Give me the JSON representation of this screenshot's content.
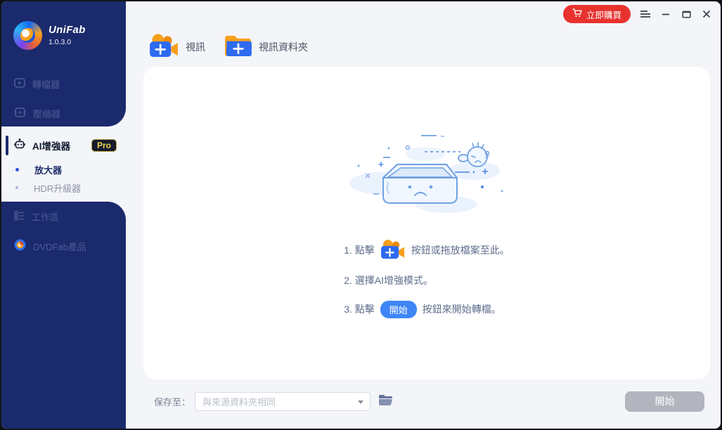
{
  "app": {
    "brand": "UniFab",
    "version": "1.0.3.0"
  },
  "titlebar": {
    "buy_label": "立即購買"
  },
  "sidebar": {
    "items": [
      {
        "label": "轉檔器"
      },
      {
        "label": "壓縮器"
      },
      {
        "label": "AI增強器",
        "badge": "Pro"
      },
      {
        "label": "放大器"
      },
      {
        "label": "HDR升級器"
      },
      {
        "label": "工作區"
      },
      {
        "label": "DVDFab產品"
      }
    ]
  },
  "toolbar": {
    "add_video_label": "視訊",
    "add_video_folder_label": "視訊資料夾"
  },
  "empty_state": {
    "step1_pre": "1. 點擊",
    "step1_post": "按鈕或拖放檔案至此。",
    "step2": "2. 選擇AI增強模式。",
    "step3_pre": "3. 點擊",
    "step3_button": "開始",
    "step3_post": "按鈕來開始轉檔。"
  },
  "bottombar": {
    "save_label": "保存至：",
    "save_value": "與來源資料夾相同",
    "start_label": "開始"
  },
  "icons": {
    "logo": "unifab-swirl",
    "buy": "cart-icon",
    "toolbar": [
      "add-video-camera-icon",
      "add-video-folder-icon"
    ],
    "sidebar": [
      "converter-play-icon",
      "compressor-icon",
      "ai-robot-icon",
      "workspace-list-icon",
      "dvdfab-logo-icon"
    ],
    "window": [
      "menu-icon",
      "minimize-icon",
      "maximize-icon",
      "close-icon"
    ],
    "bottom": [
      "dropdown-arrow-icon",
      "browse-folder-icon"
    ]
  },
  "colors": {
    "sidebar_navy": "#1a2a6c",
    "main_bg": "#f4f5f9",
    "panel_bg": "#ffffff",
    "accent_blue": "#2e6bf0",
    "brand_red": "#e8322e",
    "badge_gold": "#edd64f",
    "disabled_gray": "#b2b5be",
    "illustration_blue": "#6fa0e2"
  }
}
